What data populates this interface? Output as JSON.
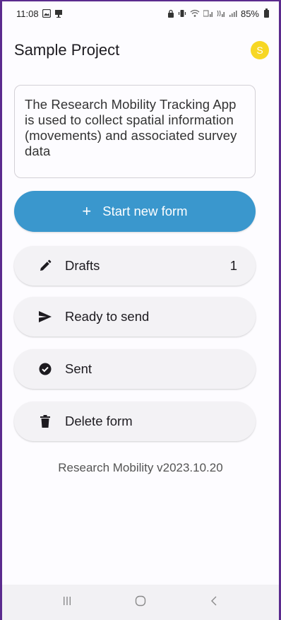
{
  "status_bar": {
    "time": "11:08",
    "left_icons": [
      "gallery-icon",
      "cast-icon"
    ],
    "right_icons": [
      "lock-icon",
      "vibrate-icon",
      "wifi-icon",
      "volte-icon",
      "signal-icon",
      "call-signal-icon"
    ],
    "battery": "85%"
  },
  "app_bar": {
    "title": "Sample Project",
    "avatar_letter": "S",
    "avatar_color": "#f7d724"
  },
  "description": "The Research Mobility Tracking App is used to collect spatial information (movements) and associated survey data",
  "primary_action": {
    "icon": "+",
    "label": "Start new form",
    "color": "#3a97cd"
  },
  "menu": {
    "drafts": {
      "icon": "pencil-icon",
      "label": "Drafts",
      "count": "1"
    },
    "ready": {
      "icon": "send-icon",
      "label": "Ready to send"
    },
    "sent": {
      "icon": "check-circle-icon",
      "label": "Sent"
    },
    "delete": {
      "icon": "trash-icon",
      "label": "Delete form"
    }
  },
  "version": "Research Mobility v2023.10.20",
  "nav_bar": {
    "recents": "recents-icon",
    "home": "home-icon",
    "back": "back-icon"
  }
}
